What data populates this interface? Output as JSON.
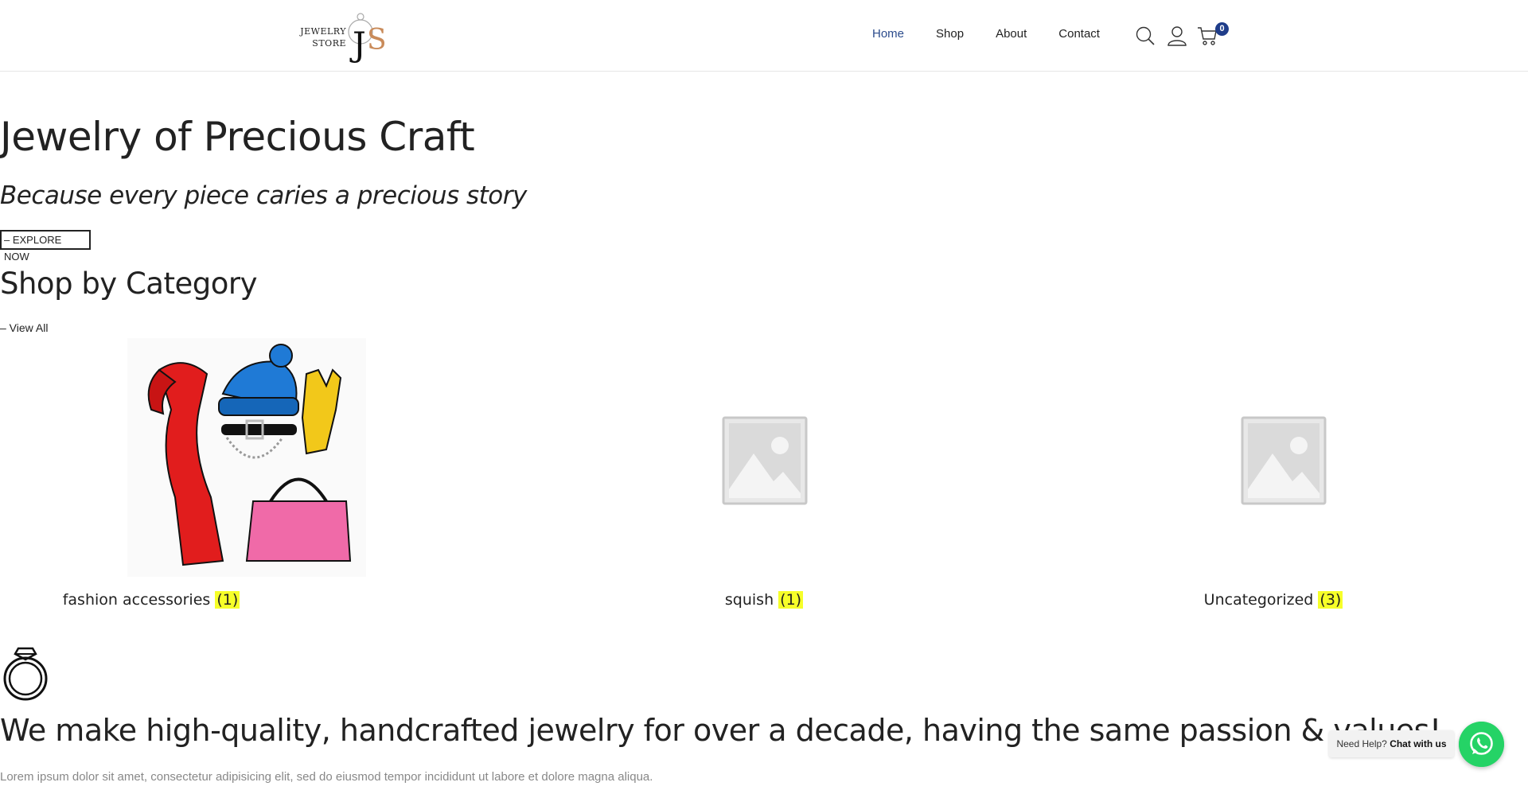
{
  "header": {
    "logo_line1": "JEWELRY",
    "logo_line2": "STORE",
    "logo_mark": "JS",
    "nav": [
      {
        "label": "Home",
        "active": true
      },
      {
        "label": "Shop",
        "active": false
      },
      {
        "label": "About",
        "active": false
      },
      {
        "label": "Contact",
        "active": false
      }
    ],
    "icons": [
      "search-icon",
      "user-icon",
      "cart-icon"
    ],
    "cart_count": "0",
    "accent_color": "#1f3d8a"
  },
  "hero": {
    "title": "Jewelry of Precious Craft",
    "subtitle": "Because every piece caries a precious story",
    "cta": "– EXPLORE NOW"
  },
  "categories_section": {
    "title": "Shop by Category",
    "view_all": "– View All",
    "items": [
      {
        "name": "fashion accessories",
        "count": "(1)",
        "image": "fashion-accessories-image"
      },
      {
        "name": "squish",
        "count": "(1)",
        "image": "placeholder-image"
      },
      {
        "name": "Uncategorized",
        "count": "(3)",
        "image": "placeholder-image"
      }
    ],
    "count_highlight": "#f6ff29"
  },
  "about": {
    "icon": "ring-icon",
    "headline": "We make high-quality, handcrafted jewelry for over a decade, having the same passion & values!",
    "body": "Lorem ipsum dolor sit amet, consectetur adipisicing elit, sed do eiusmod tempor incididunt ut labore et dolore magna aliqua."
  },
  "chat": {
    "prompt": "Need Help?",
    "action": "Chat with us",
    "icon": "whatsapp-icon",
    "color": "#25d366"
  }
}
